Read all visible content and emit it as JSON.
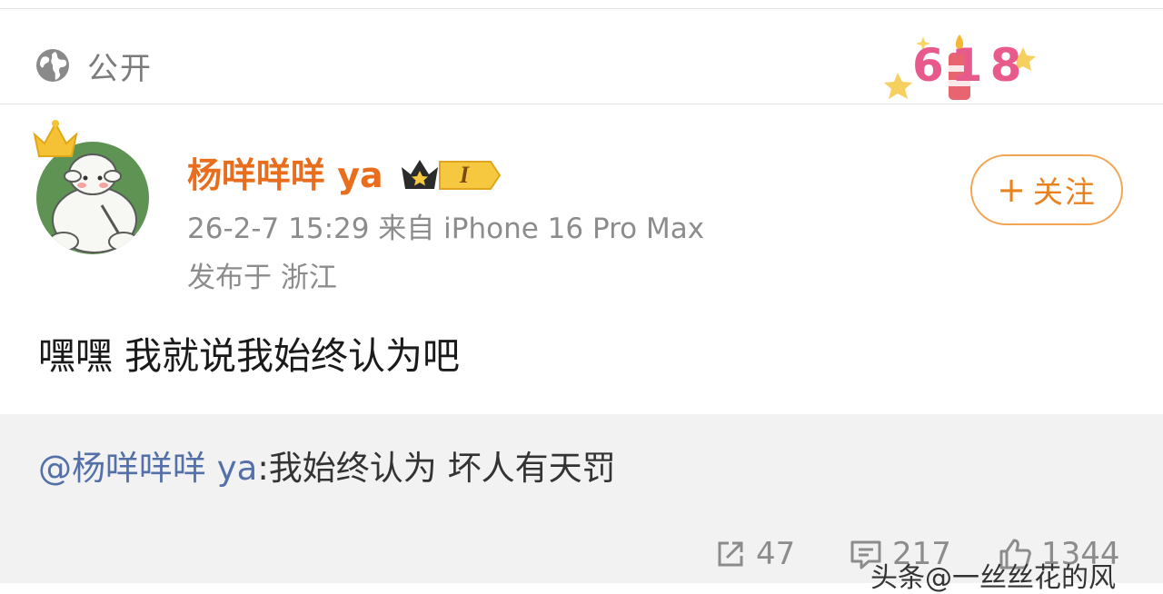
{
  "privacy": {
    "label": "公开",
    "icon": "globe-icon"
  },
  "event_badge": {
    "text": "618",
    "icon": "candle-icon"
  },
  "post": {
    "author": "杨咩咩咩 ya",
    "vip_level": "I",
    "time_source": "26-2-7 15:29  来自 iPhone 16 Pro Max",
    "location": "发布于 浙江",
    "text": "嘿嘿 我就说我始终认为吧",
    "follow_label": "关注"
  },
  "repost": {
    "mention": "@杨咩咩咩 ya",
    "text": ":我始终认为 坏人有天罚"
  },
  "stats": {
    "shares": "47",
    "comments": "217",
    "likes": "1344"
  },
  "watermark": "头条@一丝丝花的风",
  "colors": {
    "username": "#e86d1c",
    "mention": "#5470a8",
    "follow": "#e8821e",
    "repost_bg": "#f2f2f2"
  }
}
